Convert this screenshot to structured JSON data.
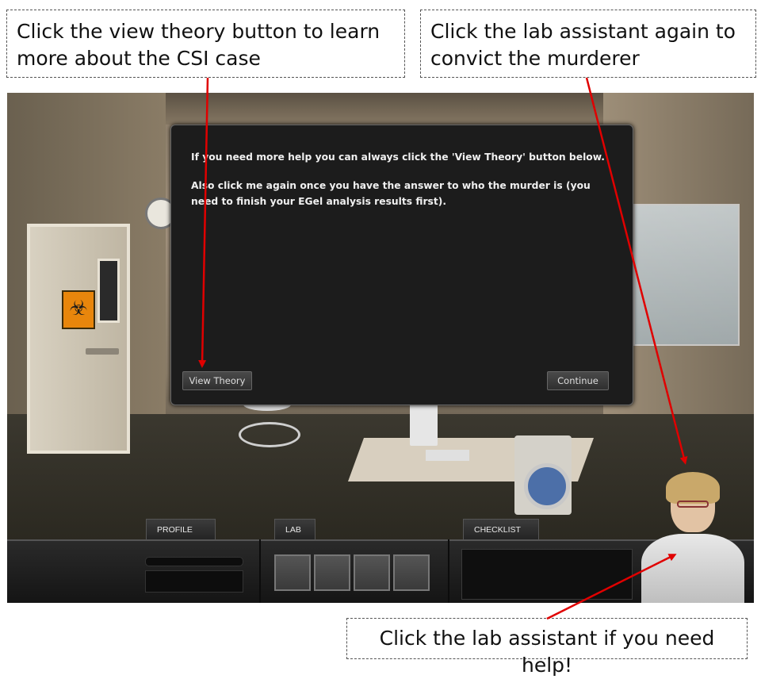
{
  "callouts": {
    "top_left": "Click the view theory button to learn more about the CSI case",
    "top_right": "Click the lab assistant again to convict the murderer",
    "bottom": "Click the lab assistant if you need help!"
  },
  "dialog": {
    "paragraph1": "If you need more help you can always click the 'View Theory' button below.",
    "paragraph2": "Also click me again once you have the answer to who the murder is (you need to finish your EGel analysis results first).",
    "view_theory_label": "View Theory",
    "continue_label": "Continue"
  },
  "hud": {
    "tabs": [
      {
        "label": "PROFILE"
      },
      {
        "label": "LAB"
      },
      {
        "label": "CHECKLIST"
      }
    ]
  },
  "colors": {
    "arrow": "#e00000",
    "dialog_bg": "#1c1c1c",
    "hazard": "#e8860c"
  }
}
